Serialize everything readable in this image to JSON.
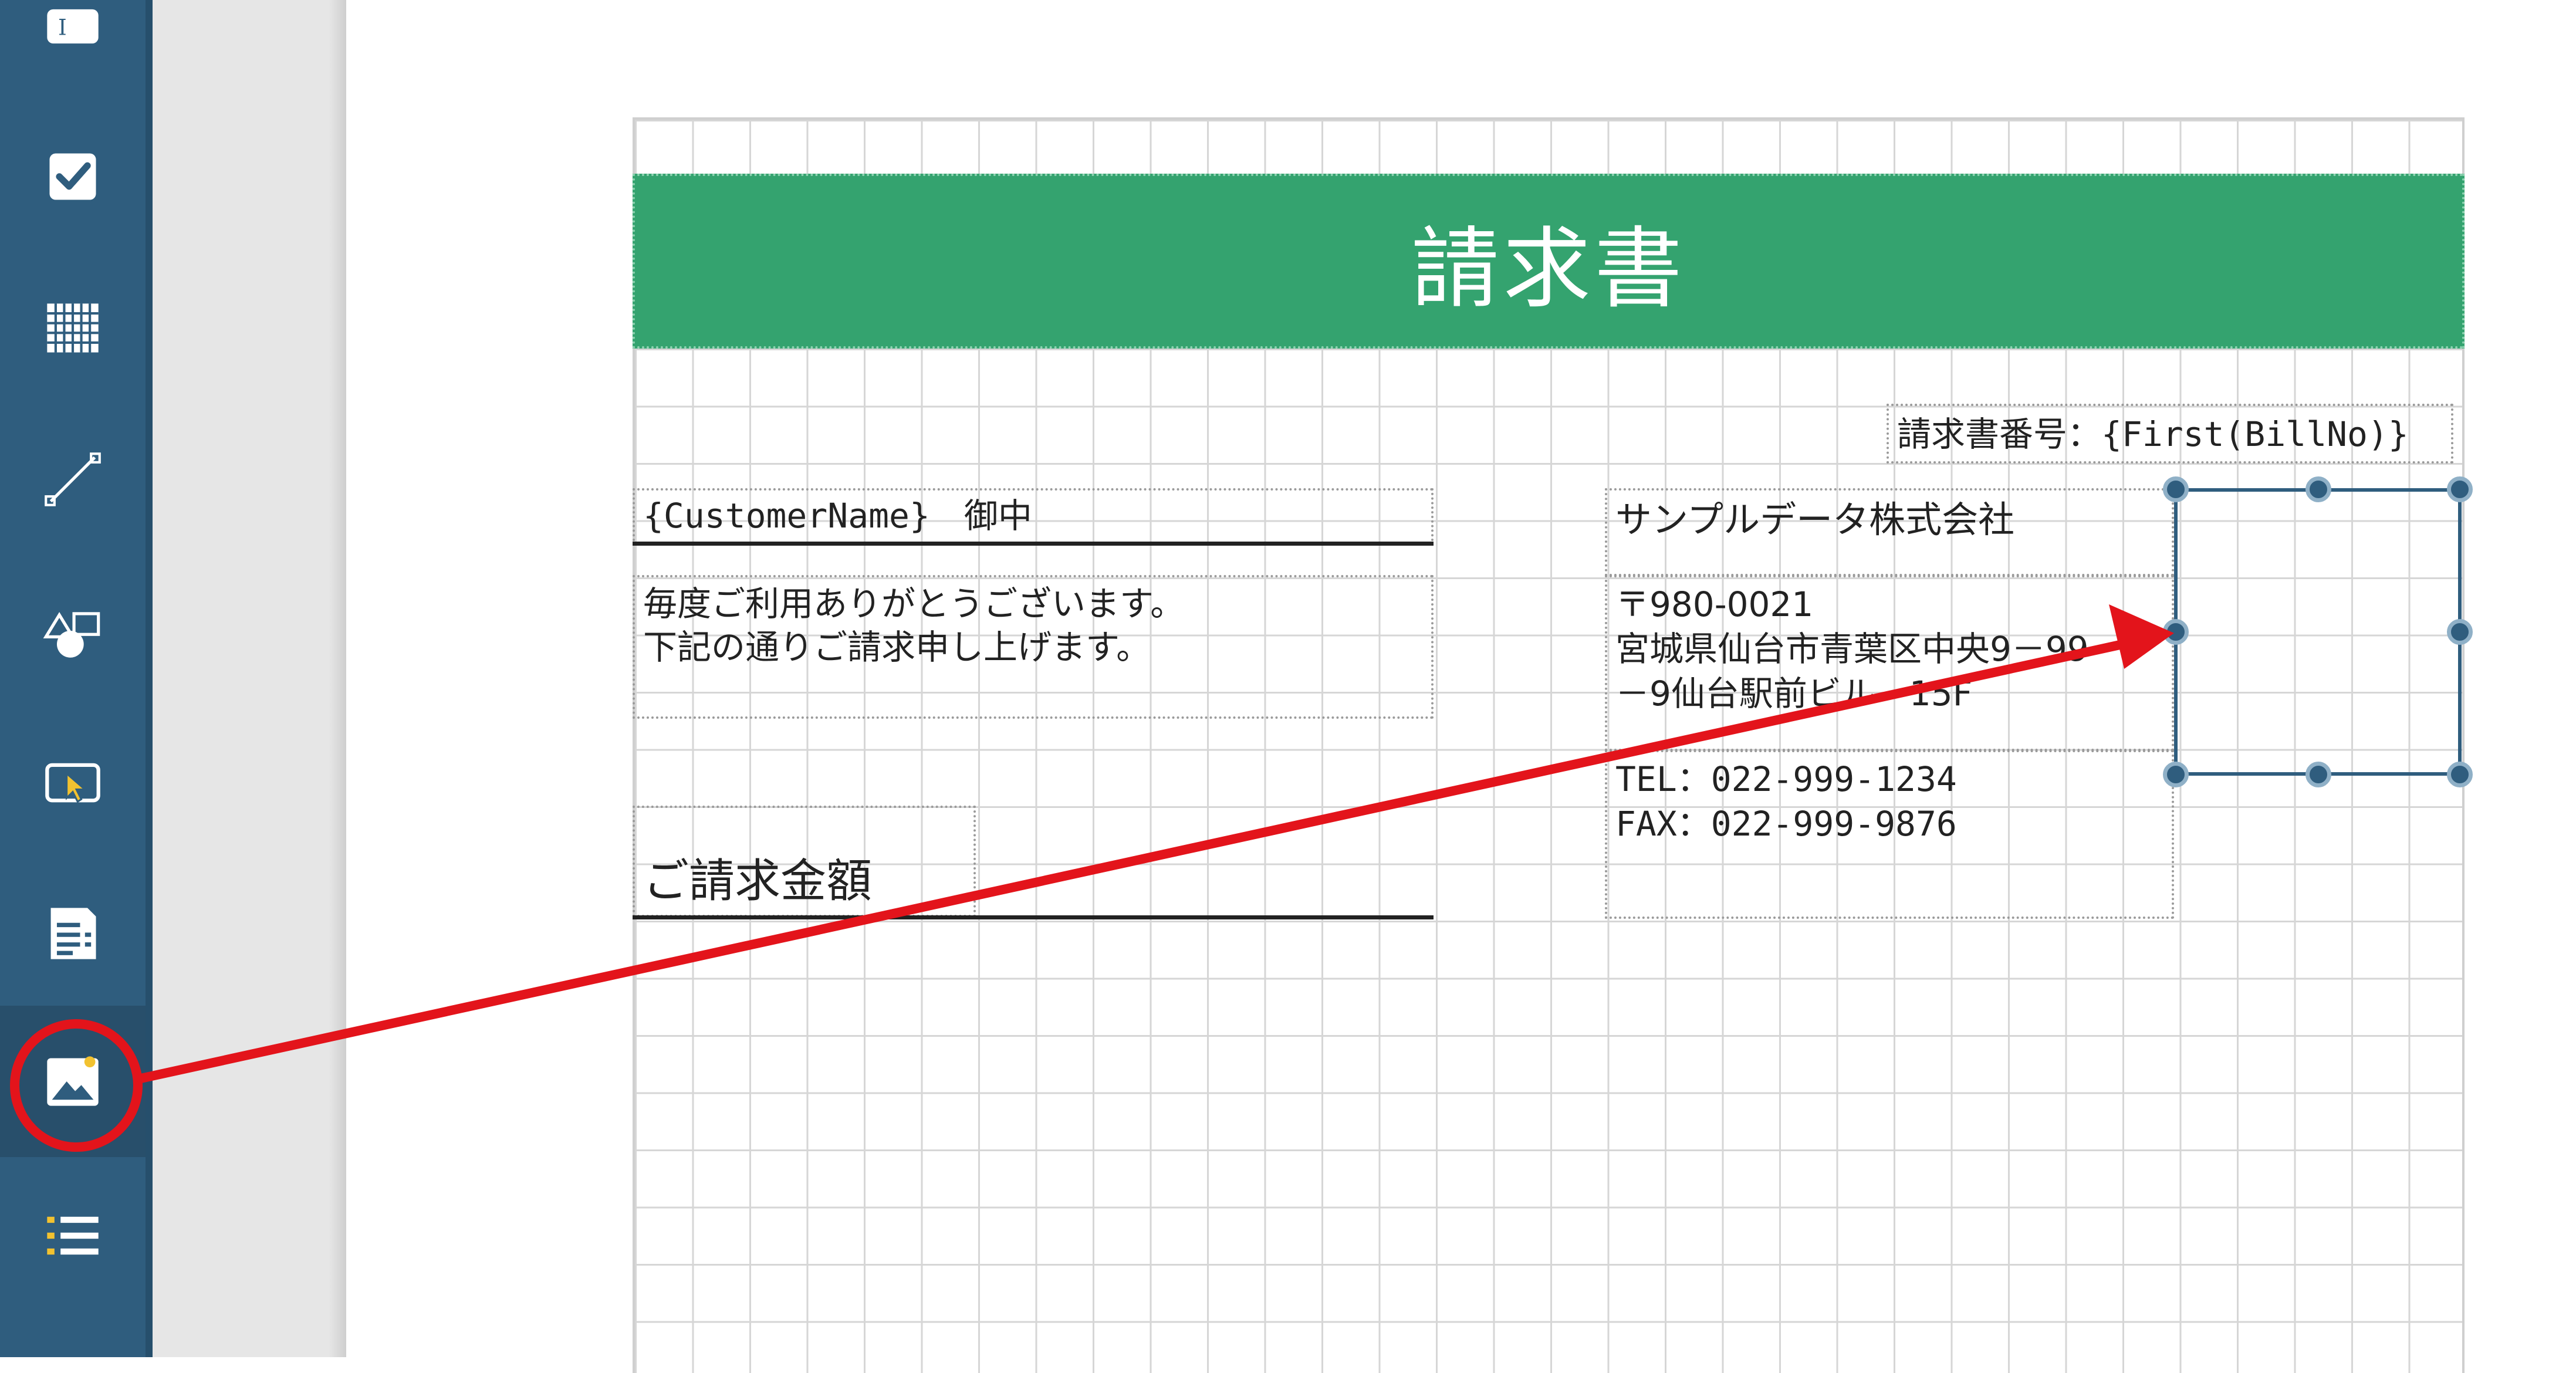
{
  "sidebar": {
    "tools": [
      {
        "name": "text-icon",
        "label": "I"
      },
      {
        "name": "checkbox-icon"
      },
      {
        "name": "table-icon"
      },
      {
        "name": "line-icon"
      },
      {
        "name": "shapes-icon"
      },
      {
        "name": "select-area-icon"
      },
      {
        "name": "document-icon"
      },
      {
        "name": "image-icon",
        "selected": true
      },
      {
        "name": "list-icon"
      }
    ]
  },
  "report": {
    "title": "請求書",
    "bill_no": "請求書番号：{First(BillNo)}",
    "customer": "{CustomerName}　御中",
    "greeting": "毎度ご利用ありがとうございます。\n下記の通りご請求申し上げます。",
    "amount_label": "ご請求金額",
    "company": "サンプルデータ株式会社",
    "address": "〒980-0021\n宮城県仙台市青葉区中央9－99\n－9仙台駅前ビル　15F",
    "contact": "TEL：022-999-1234\nFAX：022-999-9876"
  },
  "colors": {
    "sidebar": "#2f5d7e",
    "title_band": "#34a36f",
    "annotation": "#e3141b",
    "handle": "#2f5d7e"
  }
}
